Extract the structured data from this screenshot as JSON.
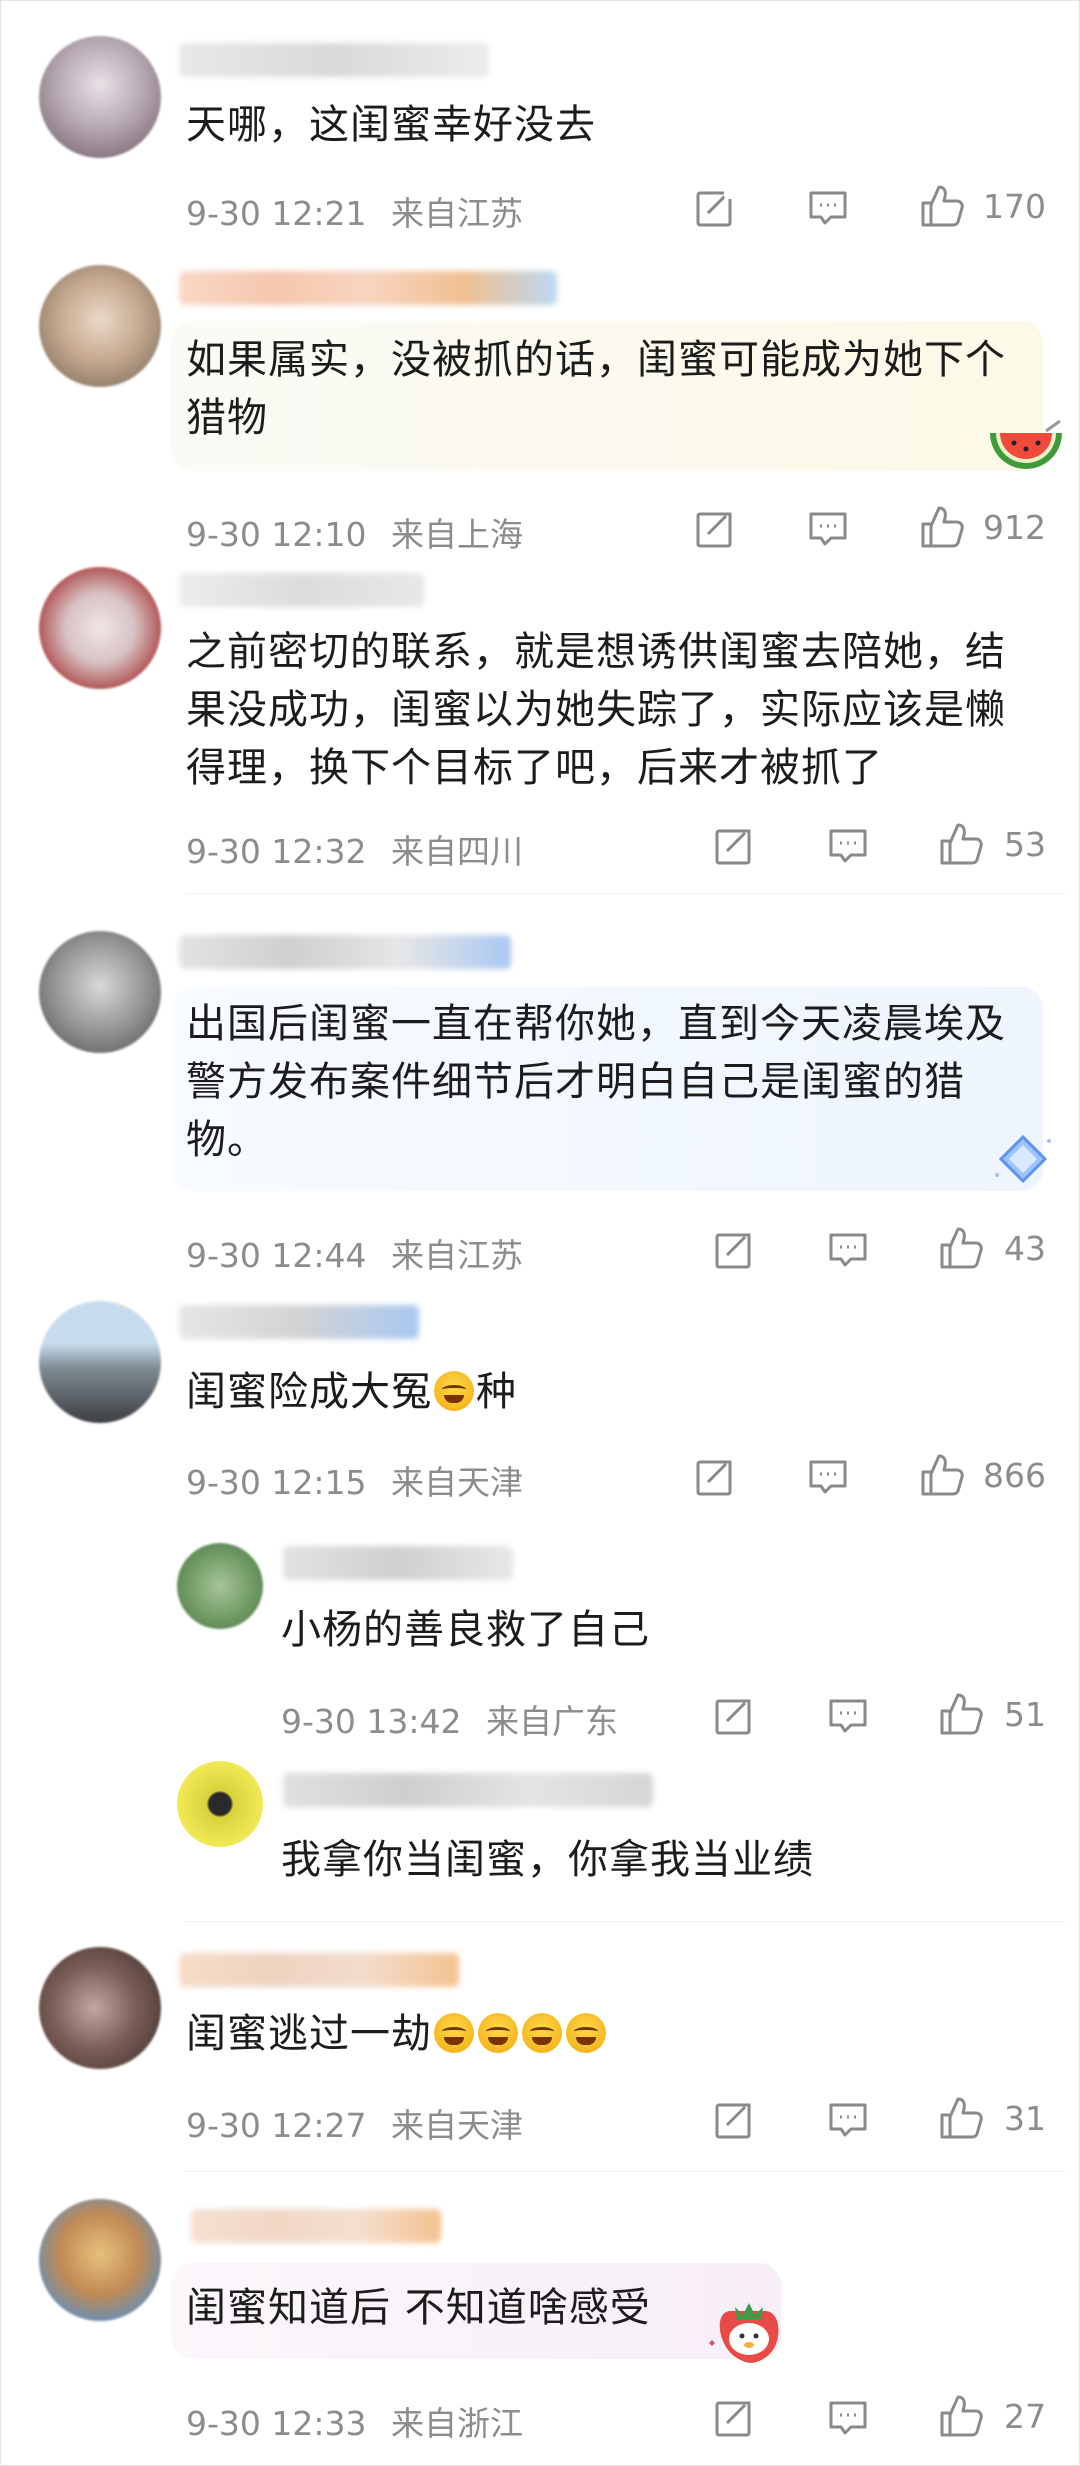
{
  "comments": [
    {
      "text": "天哪，这闺蜜幸好没去",
      "time": "9-30 12:21",
      "location": "来自江苏",
      "likes": "170"
    },
    {
      "text": "如果属实，没被抓的话，闺蜜可能成为她下个猎物",
      "time": "9-30 12:10",
      "location": "来自上海",
      "likes": "912"
    },
    {
      "text": "之前密切的联系，就是想诱供闺蜜去陪她，结果没成功，闺蜜以为她失踪了，实际应该是懒得理，换下个目标了吧，后来才被抓了",
      "time": "9-30 12:32",
      "location": "来自四川",
      "likes": "53"
    },
    {
      "text": "出国后闺蜜一直在帮你她，直到今天凌晨埃及警方发布案件细节后才明白自己是闺蜜的猎物。",
      "time": "9-30 12:44",
      "location": "来自江苏",
      "likes": "43"
    },
    {
      "text_before": "闺蜜险成大冤",
      "text_after": "种",
      "time": "9-30 12:15",
      "location": "来自天津",
      "likes": "866"
    },
    {
      "text": "闺蜜逃过一劫",
      "time": "9-30 12:27",
      "location": "来自天津",
      "likes": "31"
    },
    {
      "text": "闺蜜知道后 不知道啥感受",
      "time": "9-30 12:33",
      "location": "来自浙江",
      "likes": "27"
    }
  ],
  "replies": [
    {
      "text": "小杨的善良救了自己",
      "time": "9-30 13:42",
      "location": "来自广东",
      "likes": "51"
    },
    {
      "text": "我拿你当闺蜜，你拿我当业绩"
    }
  ],
  "icons": {
    "share": "share-icon",
    "comment": "comment-icon",
    "like": "like-icon"
  }
}
